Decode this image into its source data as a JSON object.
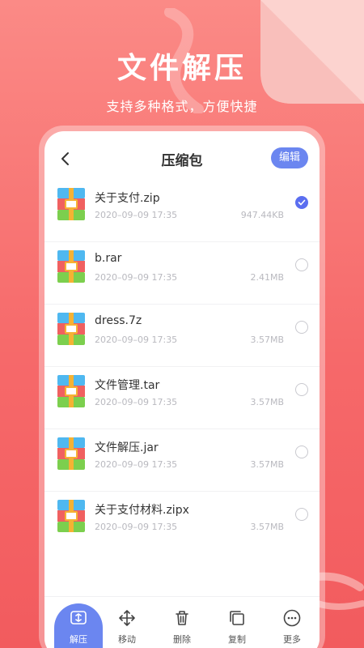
{
  "hero": {
    "title": "文件解压",
    "subtitle": "支持多种格式，方便快捷"
  },
  "header": {
    "title": "压缩包",
    "edit_label": "编辑",
    "back_icon": "chevron-left-icon"
  },
  "files": [
    {
      "name": "关于支付.zip",
      "date": "2020–09–09 17:35",
      "size": "947.44KB",
      "selected": true
    },
    {
      "name": "b.rar",
      "date": "2020–09–09 17:35",
      "size": "2.41MB",
      "selected": false
    },
    {
      "name": "dress.7z",
      "date": "2020–09–09 17:35",
      "size": "3.57MB",
      "selected": false
    },
    {
      "name": "文件管理.tar",
      "date": "2020–09–09 17:35",
      "size": "3.57MB",
      "selected": false
    },
    {
      "name": "文件解压.jar",
      "date": "2020–09–09 17:35",
      "size": "3.57MB",
      "selected": false
    },
    {
      "name": "关于支付材料.zipx",
      "date": "2020–09–09 17:35",
      "size": "3.57MB",
      "selected": false
    }
  ],
  "toolbar": [
    {
      "label": "解压",
      "icon": "extract-icon",
      "active": true
    },
    {
      "label": "移动",
      "icon": "move-icon",
      "active": false
    },
    {
      "label": "删除",
      "icon": "trash-icon",
      "active": false
    },
    {
      "label": "复制",
      "icon": "copy-icon",
      "active": false
    },
    {
      "label": "更多",
      "icon": "more-icon",
      "active": false
    }
  ],
  "colors": {
    "accent": "#6b86f0",
    "check": "#5b6ef0",
    "background": "#f6696a"
  }
}
